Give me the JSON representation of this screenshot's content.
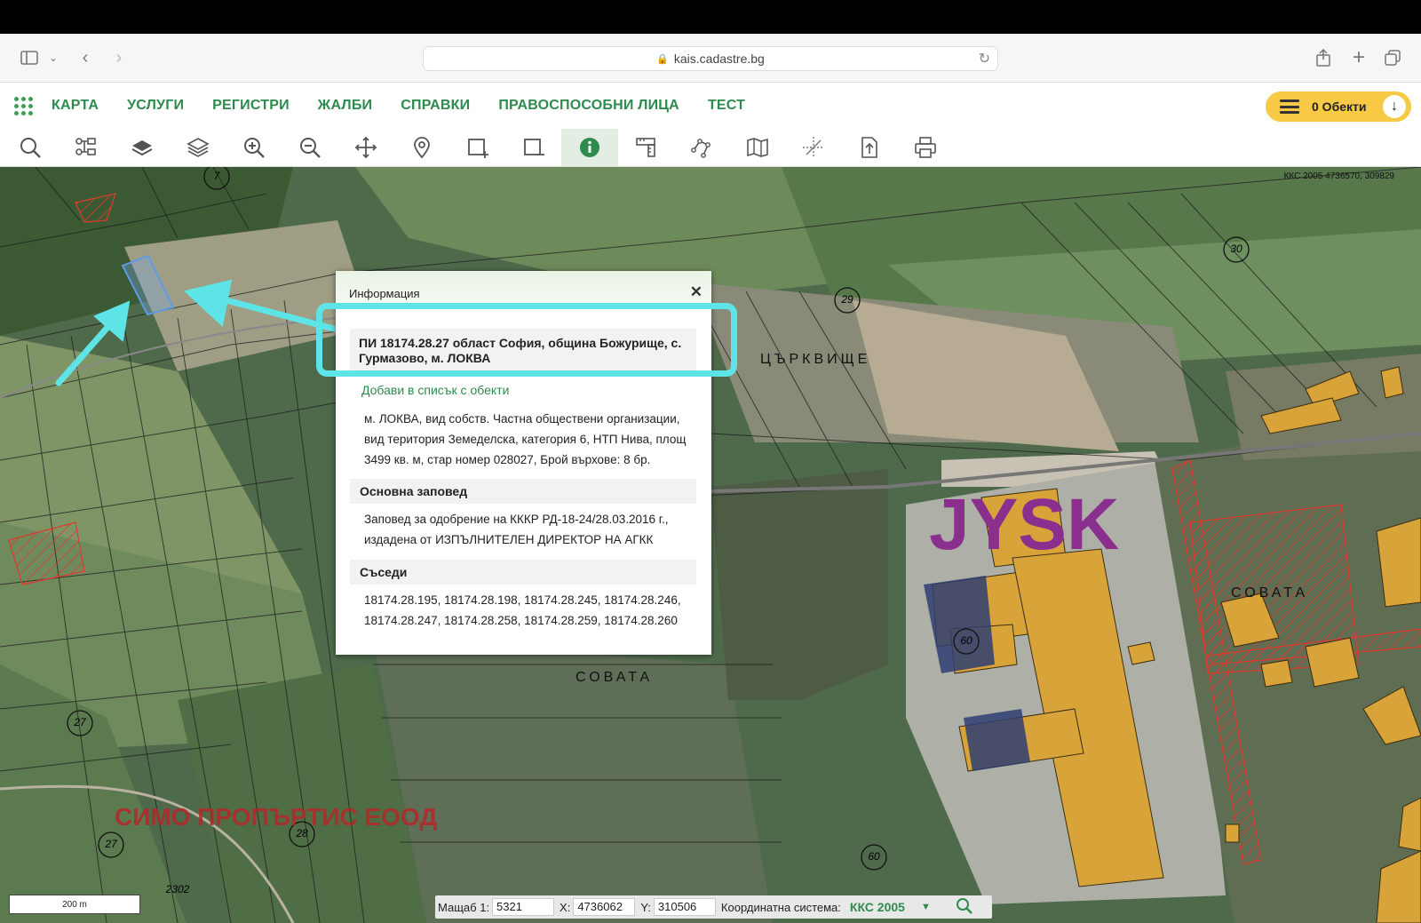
{
  "browser": {
    "url": "kais.cadastre.bg"
  },
  "nav": {
    "items": [
      "КАРТА",
      "УСЛУГИ",
      "РЕГИСТРИ",
      "ЖАЛБИ",
      "СПРАВКИ",
      "ПРАВОСПОСОБНИ ЛИЦА",
      "ТЕСТ"
    ],
    "objects_label": "0 Обекти"
  },
  "toolbar": {
    "tools": [
      "search",
      "tree",
      "layers-single",
      "layers",
      "zoom-in",
      "zoom-out",
      "pan",
      "marker",
      "select-add",
      "select-remove",
      "info",
      "measure",
      "polyline",
      "map-book",
      "crosshair",
      "export",
      "print"
    ],
    "active_tool": "info"
  },
  "map": {
    "coords_top": "ККС 2005 4736570, 309829",
    "labels": {
      "tsarkvishte": "ЦЪРКВИЩЕ",
      "sovata1": "СОВАТА",
      "sovata2": "СОВАТА",
      "jysk": "JYSK",
      "simo": "СИМО ПРОПЪРТИС ЕООД",
      "n29": "29",
      "n30": "30",
      "n60a": "60",
      "n60b": "60",
      "n27a": "27",
      "n27b": "27",
      "n28": "28",
      "n7": "7",
      "n2302": "2302"
    },
    "scale_label": "200 m"
  },
  "info": {
    "title": "Информация",
    "close": "✕",
    "parcel_title": "ПИ 18174.28.27 област София, община Божурище, с. Гурмазово, м. ЛОКВА",
    "add_link": "Добави в списък с обекти",
    "description": "м. ЛОКВА, вид собств. Частна обществени организации, вид територия Земеделска, категория 6, НТП Нива, площ 3499 кв. м, стар номер 028027, Брой върхове: 8 бр.",
    "order_heading": "Основна заповед",
    "order_text": "Заповед за одобрение на КККР РД-18-24/28.03.2016 г., издадена от ИЗПЪЛНИТЕЛЕН ДИРЕКТОР НА АГКК",
    "neighbors_heading": "Съседи",
    "neighbors_text": "18174.28.195, 18174.28.198, 18174.28.245, 18174.28.246, 18174.28.247, 18174.28.258, 18174.28.259, 18174.28.260"
  },
  "status": {
    "scale_label": "Мащаб 1:",
    "scale_value": "5321",
    "x_label": "X:",
    "x_value": "4736062",
    "y_label": "Y:",
    "y_value": "310506",
    "system_label": "Координатна система:",
    "system_value": "ККС 2005"
  },
  "colors": {
    "accent": "#2e8b4e",
    "highlight": "#5ee4e6",
    "jysk": "#8b2f8f",
    "buildings": "#d8a43a"
  }
}
